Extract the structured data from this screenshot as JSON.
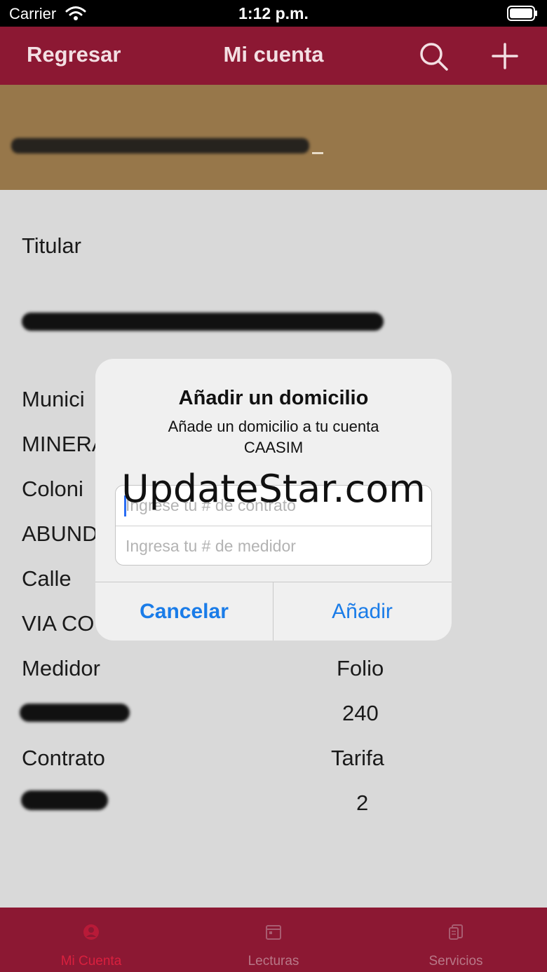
{
  "status_bar": {
    "carrier": "Carrier",
    "time": "1:12 p.m."
  },
  "nav": {
    "back": "Regresar",
    "title": "Mi cuenta"
  },
  "account": {
    "titular_label": "Titular",
    "municipio_label": "Munici",
    "municipio_value": "MINERA",
    "colonia_label": "Coloni",
    "colonia_value": "ABUND",
    "calle_label": "Calle",
    "calle_value": "VIA CO",
    "medidor_label": "Medidor",
    "folio_label": "Folio",
    "folio_value": "240",
    "contrato_label": "Contrato",
    "tarifa_label": "Tarifa",
    "tarifa_value": "2"
  },
  "dialog": {
    "title": "Añadir un domicilio",
    "message": "Añade un domicilio a tu cuenta CAASIM",
    "contract_placeholder": "Ingrese tu # de contrato",
    "meter_placeholder": "Ingresa tu # de medidor",
    "cancel": "Cancelar",
    "add": "Añadir"
  },
  "watermark": "UpdateStar.com",
  "tabs": [
    {
      "label": "Mi Cuenta",
      "icon": "user-icon",
      "active": true
    },
    {
      "label": "Lecturas",
      "icon": "calendar-icon",
      "active": false
    },
    {
      "label": "Servicios",
      "icon": "document-icon",
      "active": false
    }
  ],
  "colors": {
    "brand": "#8c1833",
    "banner": "#97774a",
    "link": "#1a7ce8"
  }
}
